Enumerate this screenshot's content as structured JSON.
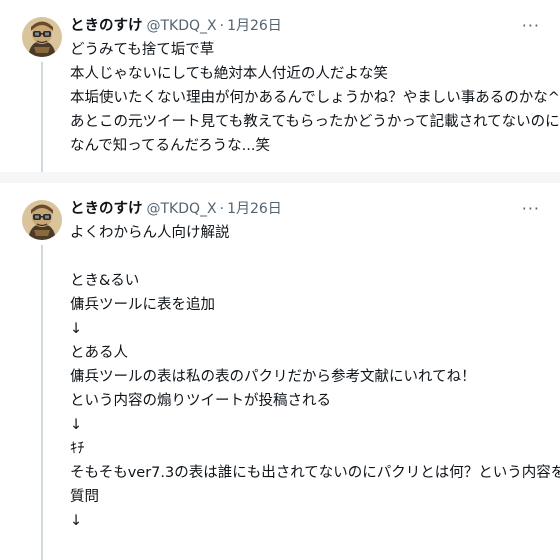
{
  "tweets": [
    {
      "name": "ときのすけ",
      "handle": "@TKDQ_X",
      "separator": "·",
      "date": "1月26日",
      "more_icon": "ellipsis-icon",
      "lines": [
        "どうみても捨て垢で草",
        "本人じゃないにしても絶対本人付近の人だよな笑",
        "本垢使いたくない理由が何かあるんでしょうかね？やましい事あるのかな^^",
        "あとこの元ツイート見ても教えてもらったかどうかって記載されてないのに",
        "なんで知ってるんだろうな...笑"
      ]
    },
    {
      "name": "ときのすけ",
      "handle": "@TKDQ_X",
      "separator": "·",
      "date": "1月26日",
      "more_icon": "ellipsis-icon",
      "lines": [
        "よくわからん人向け解説",
        "",
        "とき&るい",
        "傭兵ツールに表を追加",
        "↓",
        "とある人",
        "傭兵ツールの表は私の表のパクリだから参考文献にいれてね！",
        "という内容の煽りツイートが投稿される",
        "↓",
        "ｷﾁ",
        "そもそもver7.3の表は誰にも出されてないのにパクリとは何？という内容を",
        "質問",
        "↓"
      ]
    }
  ]
}
